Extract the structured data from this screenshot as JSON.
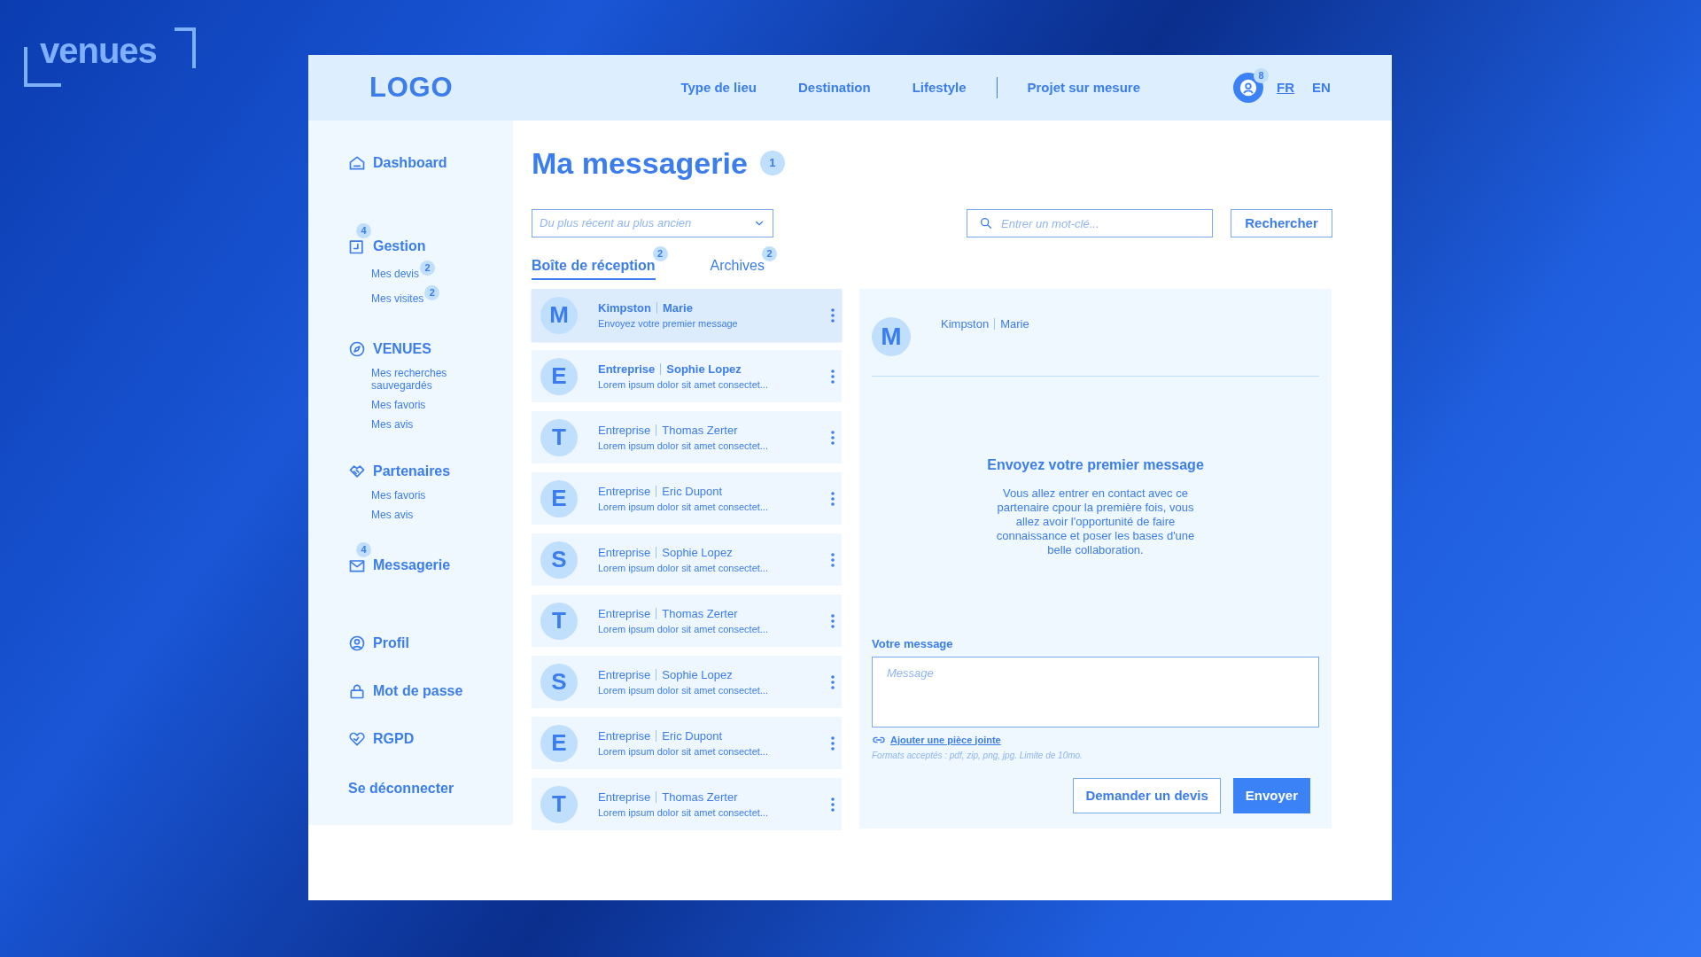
{
  "brand": {
    "text": "venues"
  },
  "header": {
    "logo": "LOGO",
    "nav": [
      {
        "label": "Type de lieu"
      },
      {
        "label": "Destination"
      },
      {
        "label": "Lifestyle"
      }
    ],
    "nav_extra": "Projet sur mesure",
    "notifications": "8",
    "languages": [
      {
        "label": "FR",
        "selected": true
      },
      {
        "label": "EN",
        "selected": false
      }
    ]
  },
  "sidebar": {
    "sections": [
      {
        "kind": "home",
        "label": "Dashboard"
      },
      {
        "kind": "document",
        "label": "Gestion",
        "badge": "4",
        "children": [
          {
            "label": "Mes devis",
            "badge": "2"
          },
          {
            "label": "Mes visites",
            "badge": "2"
          }
        ]
      },
      {
        "kind": "compass",
        "label": "VENUES",
        "children": [
          {
            "label": "Mes recherches sauvegardés"
          },
          {
            "label": "Mes favoris"
          },
          {
            "label": "Mes avis"
          }
        ]
      },
      {
        "kind": "handshake",
        "label": "Partenaires",
        "children": [
          {
            "label": "Mes favoris"
          },
          {
            "label": "Mes avis"
          }
        ]
      },
      {
        "kind": "mail",
        "label": "Messagerie",
        "badge": "4"
      },
      {
        "kind": "user",
        "label": "Profil"
      },
      {
        "kind": "lock",
        "label": "Mot de passe"
      },
      {
        "kind": "heart",
        "label": "RGPD"
      }
    ],
    "logout": "Se déconnecter"
  },
  "page": {
    "title": "Ma messagerie",
    "title_badge": "1",
    "sort": {
      "placeholder": "Du plus récent au plus ancien"
    },
    "search": {
      "placeholder": "Entrer un mot-clé..."
    },
    "search_button": "Rechercher",
    "tabs": [
      {
        "label": "Boîte de réception",
        "badge": "2",
        "selected": true
      },
      {
        "label": "Archives",
        "badge": "2",
        "selected": false
      }
    ]
  },
  "conversations": [
    {
      "initial": "M",
      "company": "Kimpston",
      "name": "Marie",
      "preview": "Envoyez votre premier message",
      "selected": true,
      "unread": true
    },
    {
      "initial": "E",
      "company": "Entreprise",
      "name": "Sophie Lopez",
      "preview": "Lorem ipsum dolor sit amet consectet...",
      "selected": false,
      "unread": true
    },
    {
      "initial": "T",
      "company": "Entreprise",
      "name": "Thomas Zerter",
      "preview": "Lorem ipsum dolor sit amet consectet...",
      "selected": false,
      "unread": false
    },
    {
      "initial": "E",
      "company": "Entreprise",
      "name": "Eric Dupont",
      "preview": "Lorem ipsum dolor sit amet consectet...",
      "selected": false,
      "unread": false
    },
    {
      "initial": "S",
      "company": "Entreprise",
      "name": "Sophie Lopez",
      "preview": "Lorem ipsum dolor sit amet consectet...",
      "selected": false,
      "unread": false
    },
    {
      "initial": "T",
      "company": "Entreprise",
      "name": "Thomas Zerter",
      "preview": "Lorem ipsum dolor sit amet consectet...",
      "selected": false,
      "unread": false
    },
    {
      "initial": "S",
      "company": "Entreprise",
      "name": "Sophie Lopez",
      "preview": "Lorem ipsum dolor sit amet consectet...",
      "selected": false,
      "unread": false
    },
    {
      "initial": "E",
      "company": "Entreprise",
      "name": "Eric Dupont",
      "preview": "Lorem ipsum dolor sit amet consectet...",
      "selected": false,
      "unread": false
    },
    {
      "initial": "T",
      "company": "Entreprise",
      "name": "Thomas Zerter",
      "preview": "Lorem ipsum dolor sit amet consectet...",
      "selected": false,
      "unread": false
    }
  ],
  "detail": {
    "initial": "M",
    "company": "Kimpston",
    "name": "Marie",
    "heading": "Envoyez votre premier message",
    "body": "Vous allez entrer en contact avec ce partenaire cpour la première fois, vous allez avoir l'opportunité de faire connaissance et poser les bases d'une belle collaboration.",
    "message_label": "Votre message",
    "message_placeholder": "Message",
    "attach_link": "Ajouter une pièce jointe",
    "formats": "Formats acceptés : pdf, zip, png, jpg. Limite de 10mo.",
    "buttons": [
      {
        "label": "Demander un devis",
        "kind": "secondary"
      },
      {
        "label": "Envoyer",
        "kind": "primary"
      }
    ]
  }
}
